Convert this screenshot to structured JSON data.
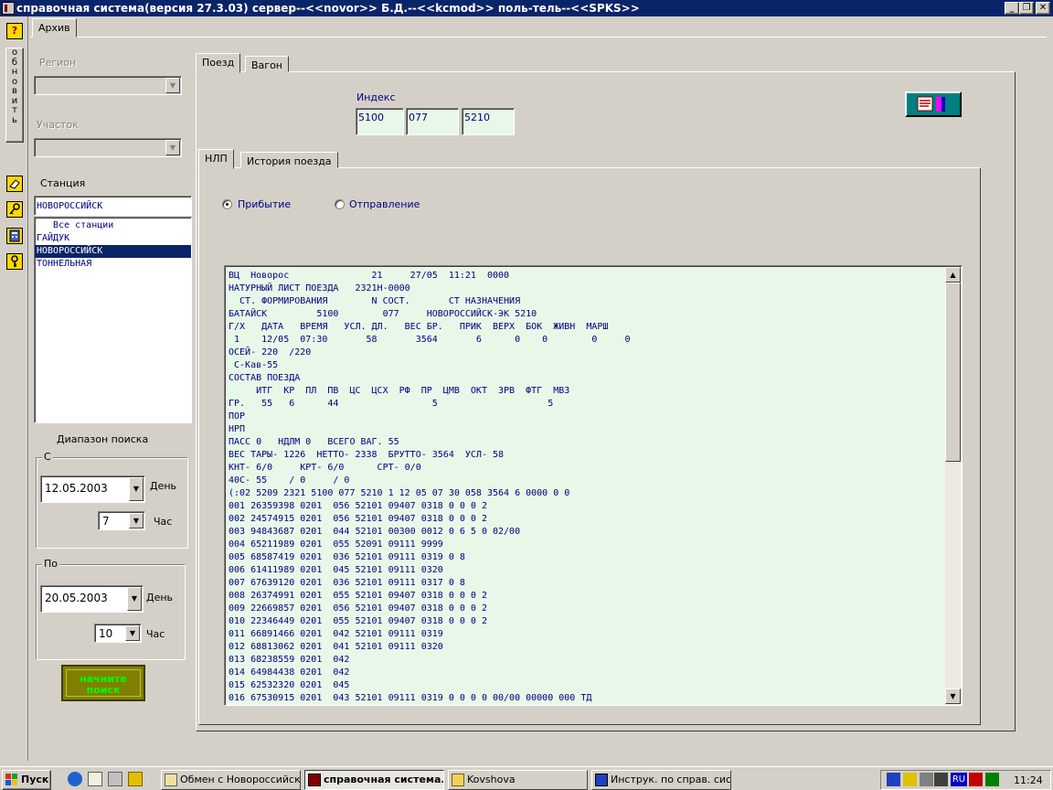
{
  "window": {
    "title": "справочная система(версия 27.3.03) сервер--<<novor>> Б.Д.--<<kcmod>> поль-тель--<<SPKS>>",
    "controls": [
      "_",
      "❐",
      "✕"
    ]
  },
  "toolbar": {
    "help_label": "?",
    "refresh_letters": [
      "о",
      "б",
      "н",
      "о",
      "в",
      "и",
      "т",
      "ь"
    ],
    "icons": [
      "eraser-icon",
      "key-icon",
      "calculator-icon",
      "key-icon"
    ]
  },
  "archive_tab": "Архив",
  "filters": {
    "region_label": "Регион",
    "section_label": "Участок",
    "station_label": "Станция",
    "station_value": "НОВОРОССИЙСК",
    "stations": [
      "   Все станции",
      "ГАЙДУК",
      "НОВОРОССИЙСК",
      "ТОННЕЛЬНАЯ"
    ],
    "selected_station_index": 2
  },
  "search_range": {
    "title": "Диапазон поиска",
    "from": {
      "title": "С",
      "date": "12.05.2003",
      "day_label": "День",
      "hour": "7",
      "hour_label": "Час"
    },
    "to": {
      "title": "По",
      "date": "20.05.2003",
      "day_label": "День",
      "hour": "10",
      "hour_label": "Час"
    },
    "start_button": [
      "начните",
      "поиск"
    ]
  },
  "main_tabs": [
    "Поезд",
    "Вагон"
  ],
  "index": {
    "label": "Индекс",
    "values": [
      "5100",
      "077",
      "5210"
    ]
  },
  "sub_tabs": [
    "НЛП",
    "История поезда"
  ],
  "direction": {
    "arrival": "Прибытие",
    "departure": "Отправление",
    "selected": "arrival"
  },
  "report_lines": [
    "ВЦ  Новорос               21     27/05  11:21  0000",
    "НАТУРНЫЙ ЛИСТ ПОЕЗДА   2321Н-0000",
    "  СТ. ФОРМИРОВАНИЯ        N СОСТ.       СТ НАЗНАЧЕНИЯ",
    "БАТАЙСК         5100        077     НОВОРОССИЙСК-ЭК 5210",
    "Г/Х   ДАТА   ВРЕМЯ   УСЛ. ДЛ.   ВЕС БР.   ПРИК  ВЕРХ  БОК  ЖИВН  МАРШ",
    " 1    12/05  07:30       58       3564       6      0    0        0     0",
    "ОСЕЙ- 220  /220",
    " С-Кав-55",
    "СОСТАВ ПОЕЗДА",
    "     ИТГ  КР  ПЛ  ПВ  ЦС  ЦСХ  РФ  ПР  ЦМВ  ОКТ  ЗРВ  ФТГ  МВЗ",
    "ГР.   55   6      44                 5                    5",
    "ПОР",
    "НРП",
    "ПАСС 0   НДЛМ 0   ВСЕГО ВАГ. 55",
    "ВЕС ТАРЫ- 1226  НЕТТО- 2338  БРУТТО- 3564  УСЛ- 58",
    "КНТ- 6/0     КРТ- 6/0      СРТ- 0/0",
    "40С- 55    / 0     / 0",
    "(:02 5209 2321 5100 077 5210 1 12 05 07 30 058 3564 6 0000 0 0",
    "001 26359398 0201  056 52101 09407 0318 0 0 0 2",
    "002 24574915 0201  056 52101 09407 0318 0 0 0 2",
    "003 94843687 0201  044 52101 00300 0012 0 6 5 0 02/00",
    "004 65211989 0201  055 52091 09111 9999",
    "005 68587419 0201  036 52101 09111 0319 0 8",
    "006 61411989 0201  045 52101 09111 0320",
    "007 67639120 0201  036 52101 09111 0317 0 8",
    "008 26374991 0201  055 52101 09407 0318 0 0 0 2",
    "009 22669857 0201  056 52101 09407 0318 0 0 0 2",
    "010 22346449 0201  055 52101 09407 0318 0 0 0 2",
    "011 66891466 0201  042 52101 09111 0319",
    "012 68813062 0201  041 52101 09111 0320",
    "013 68238559 0201  042",
    "014 64984438 0201  042",
    "015 62532320 0201  045",
    "016 67530915 0201  043 52101 09111 0319 0 0 0 0 00/00 00000 000 ТД"
  ],
  "taskbar": {
    "start": "Пуск",
    "tasks": [
      "Обмен с Новороссийск...",
      "справочная система...",
      "Kovshova",
      "Инструк. по справ. сис..."
    ],
    "active_task_index": 1,
    "lang": "RU",
    "clock": "11:24"
  }
}
